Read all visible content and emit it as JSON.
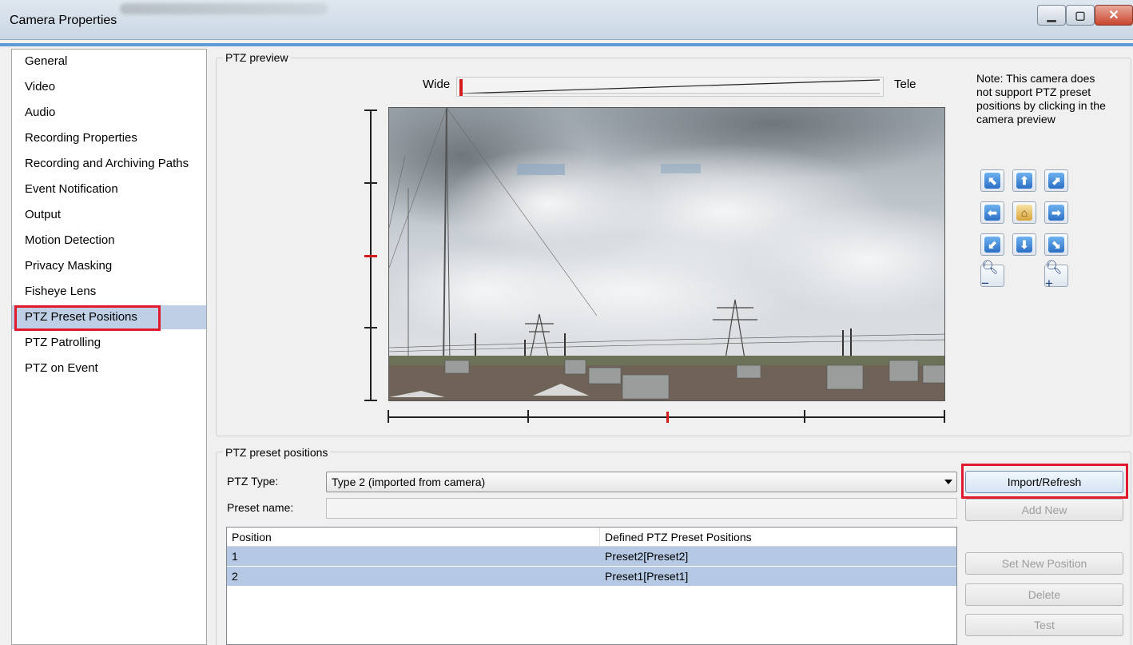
{
  "window": {
    "title": "Camera Properties",
    "minimize_glyph": "▁",
    "maximize_glyph": "▢",
    "close_glyph": "✕"
  },
  "sidebar": {
    "items": [
      {
        "label": "General"
      },
      {
        "label": "Video"
      },
      {
        "label": "Audio"
      },
      {
        "label": "Recording Properties"
      },
      {
        "label": "Recording and Archiving Paths"
      },
      {
        "label": "Event Notification"
      },
      {
        "label": "Output"
      },
      {
        "label": "Motion Detection"
      },
      {
        "label": "Privacy Masking"
      },
      {
        "label": "Fisheye Lens"
      },
      {
        "label": "PTZ Preset Positions",
        "selected": true
      },
      {
        "label": "PTZ Patrolling"
      },
      {
        "label": "PTZ on Event"
      }
    ]
  },
  "preview": {
    "group_label": "PTZ preview",
    "zoom_wide_label": "Wide",
    "zoom_tele_label": "Tele",
    "zoom_level": 0.0,
    "tilt_level": 0.5,
    "pan_level": 0.5,
    "note": "Note: This camera does not support PTZ preset positions by clicking in the camera preview",
    "controls": [
      {
        "name": "pan-up-left-button",
        "glyph": "⬉",
        "kind": "arrow"
      },
      {
        "name": "tilt-up-button",
        "glyph": "⬆",
        "kind": "arrow"
      },
      {
        "name": "pan-up-right-button",
        "glyph": "⬈",
        "kind": "arrow"
      },
      {
        "name": "pan-left-button",
        "glyph": "⬅",
        "kind": "arrow"
      },
      {
        "name": "home-button",
        "glyph": "⌂",
        "kind": "home"
      },
      {
        "name": "pan-right-button",
        "glyph": "➡",
        "kind": "arrow"
      },
      {
        "name": "pan-down-left-button",
        "glyph": "⬋",
        "kind": "arrow"
      },
      {
        "name": "tilt-down-button",
        "glyph": "⬇",
        "kind": "arrow"
      },
      {
        "name": "pan-down-right-button",
        "glyph": "⬊",
        "kind": "arrow"
      },
      {
        "name": "zoom-out-button",
        "glyph": "🔍︎−",
        "kind": "zoom"
      },
      {
        "name": "zoom-in-button",
        "glyph": "🔍︎+",
        "kind": "zoom"
      }
    ]
  },
  "presets": {
    "group_label": "PTZ preset positions",
    "ptz_type_label": "PTZ Type:",
    "ptz_type_value": "Type 2 (imported from camera)",
    "preset_name_label": "Preset name:",
    "preset_name_value": "",
    "buttons": {
      "import_refresh": "Import/Refresh",
      "add_new": "Add New",
      "set_new_position": "Set New Position",
      "delete": "Delete",
      "test": "Test"
    },
    "table": {
      "columns": [
        "Position",
        "Defined PTZ Preset Positions"
      ],
      "rows": [
        [
          "1",
          "Preset2[Preset2]"
        ],
        [
          "2",
          "Preset1[Preset1]"
        ]
      ]
    }
  },
  "colors": {
    "highlight_box": "#e0192c",
    "selection": "#bfd0e6",
    "accent": "#5d9ad6"
  }
}
